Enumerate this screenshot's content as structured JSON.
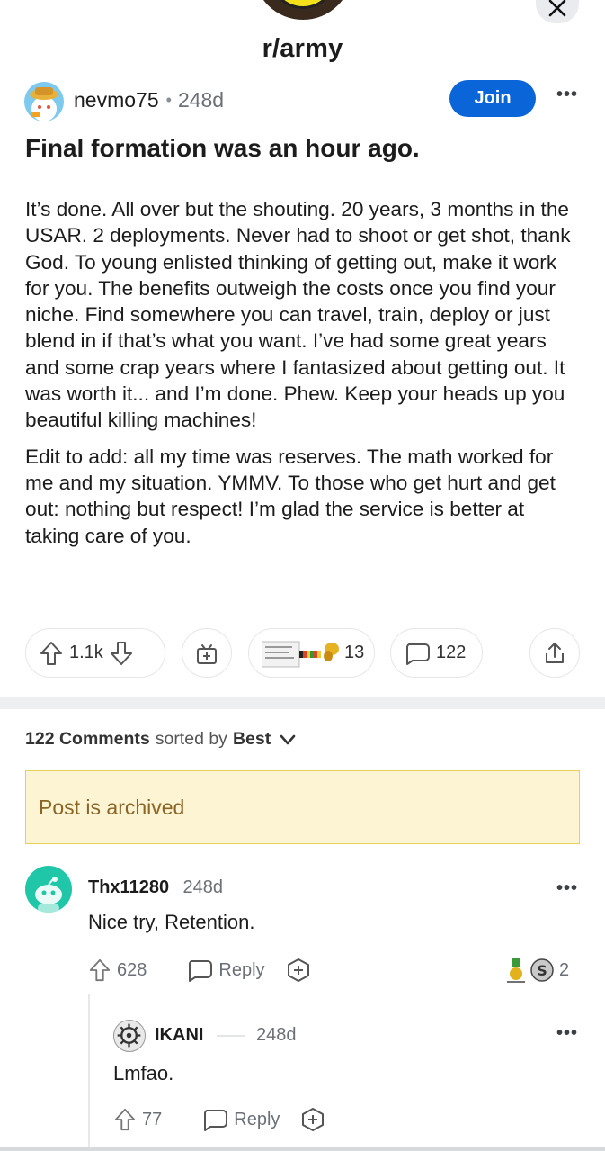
{
  "header": {
    "subreddit": "r/army",
    "close_icon": "close-icon"
  },
  "post": {
    "author": "nevmo75",
    "age": "248d",
    "join_label": "Join",
    "title": "Final formation was an hour ago.",
    "body": [
      "It’s done. All over but the shouting. 20 years, 3 months in the USAR. 2 deployments. Never had to shoot or get shot, thank God. To young enlisted thinking of getting out, make it work for you. The benefits outweigh the costs once you find your niche. Find somewhere you can travel, train, deploy or just blend in if that’s what you want. I’ve had some great years and some crap years where I fantasized about getting out. It was worth it... and I’m done. Phew. Keep your heads up you beautiful killing machines!",
      "Edit to add: all my time was reserves. The math worked for me and my situation. YMMV. To those who get hurt and get out: nothing but respect! I’m glad the service is better at taking care of you."
    ],
    "votes": "1.1k",
    "awards_count": "13",
    "comments_count": "122"
  },
  "comments_section": {
    "count_label": "122 Comments",
    "sorted_by_label": "sorted by",
    "sort_value": "Best",
    "archived_notice": "Post is archived"
  },
  "comments": [
    {
      "author": "Thx11280",
      "age": "248d",
      "text": "Nice try, Retention.",
      "votes": "628",
      "reply_label": "Reply",
      "awards_count": "2"
    },
    {
      "author": "IKANI",
      "age": "248d",
      "text": "Lmfao.",
      "votes": "77",
      "reply_label": "Reply"
    }
  ],
  "colors": {
    "join": "#0a66d8",
    "archived_bg": "#fcf4d3",
    "archived_border": "#e8cf5a",
    "archived_text": "#8a6526",
    "avatar_teal": "#1fc7a8"
  }
}
